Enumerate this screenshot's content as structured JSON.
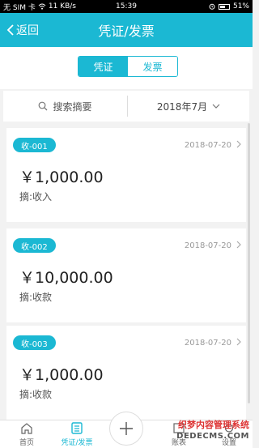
{
  "status_bar": {
    "carrier": "无 SIM 卡",
    "speed": "11 KB/s",
    "time": "15:39",
    "battery": "51%"
  },
  "header": {
    "back_label": "返回",
    "title": "凭证/发票"
  },
  "segment": {
    "tabs": [
      {
        "label": "凭证",
        "active": true
      },
      {
        "label": "发票",
        "active": false
      }
    ]
  },
  "filter": {
    "search_placeholder": "搜索摘要",
    "date_label": "2018年7月"
  },
  "vouchers": [
    {
      "code": "收-001",
      "date": "2018-07-20",
      "amount": "￥1,000.00",
      "memo": "摘:收入"
    },
    {
      "code": "收-002",
      "date": "2018-07-20",
      "amount": "￥10,000.00",
      "memo": "摘:收款"
    },
    {
      "code": "收-003",
      "date": "2018-07-20",
      "amount": "￥1,000.00",
      "memo": "摘:收款"
    }
  ],
  "tab_bar": {
    "items": [
      {
        "label": "首页",
        "icon": "home-icon"
      },
      {
        "label": "凭证/发票",
        "icon": "list-icon",
        "active": true
      },
      {
        "label": "账表",
        "icon": "report-icon"
      },
      {
        "label": "设置",
        "icon": "settings-icon"
      }
    ],
    "add_icon": "plus-icon"
  },
  "watermark": {
    "line1": "织梦内容管理系统",
    "line2": "DEDECMS.COM"
  },
  "colors": {
    "accent": "#1bb8d3",
    "background": "#f2f2f2"
  }
}
